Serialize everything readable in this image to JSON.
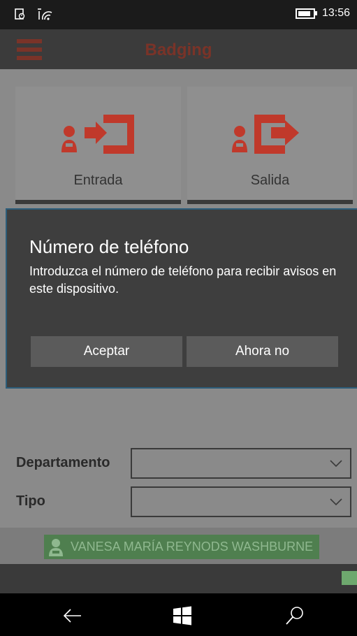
{
  "status_bar": {
    "time": "13:56",
    "icons": [
      "phone-call-icon",
      "wifi-icon",
      "battery-icon"
    ]
  },
  "app_bar": {
    "title": "Badging",
    "menu_icon": "hamburger-icon",
    "accent_color": "#7a3328"
  },
  "tiles": {
    "entry_label": "Entrada",
    "exit_label": "Salida",
    "entry_icon": "person-enter-door-icon",
    "exit_icon": "person-exit-door-icon",
    "icon_color": "#c0392b"
  },
  "dialog": {
    "title": "Número de teléfono",
    "message": "Introduzca el número de teléfono para recibir avisos en este dispositivo.",
    "accept_label": "Aceptar",
    "later_label": "Ahora no"
  },
  "form": {
    "department_label": "Departamento",
    "department_value": "",
    "type_label": "Tipo",
    "type_value": ""
  },
  "user": {
    "name": "VANESA MARÍA REYNODS WASHBURNE",
    "icon": "user-icon"
  },
  "nav": {
    "icons": [
      "back-arrow-icon",
      "windows-start-icon",
      "search-icon"
    ]
  }
}
